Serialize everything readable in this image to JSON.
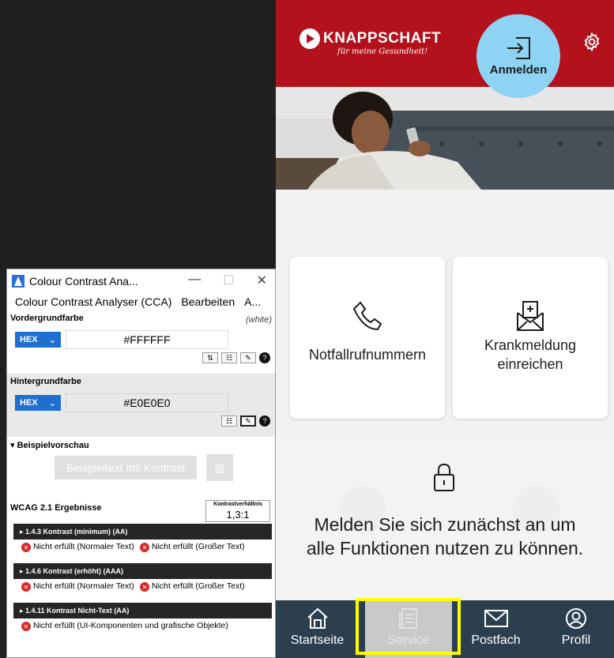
{
  "cca": {
    "title": "Colour Contrast Ana...",
    "menu": [
      "Colour Contrast Analyser (CCA)",
      "Bearbeiten",
      "A..."
    ],
    "window_controls": {
      "minimize": "—",
      "maximize": "☐",
      "close": "✕"
    },
    "foreground": {
      "label": "Vordergrundfarbe",
      "note": "(white)",
      "format": "HEX",
      "value": "#FFFFFF"
    },
    "background": {
      "label": "Hintergrundfarbe",
      "format": "HEX",
      "value": "#E0E0E0"
    },
    "preview": {
      "label": "▾ Beispielvorschau",
      "sample_text": "Beispieltext mit Kontrast"
    },
    "results": {
      "label": "WCAG 2.1 Ergebnisse",
      "ratio_label": "Kontrastverhältnis",
      "ratio_value": "1,3:1",
      "criteria": [
        {
          "title": "▸ 1.4.3 Kontrast (minimum) (AA)",
          "normal": "Nicht erfüllt (Normaler Text)",
          "large": "Nicht erfüllt (Großer Text)"
        },
        {
          "title": "▸ 1.4.6 Kontrast (erhöht) (AAA)",
          "normal": "Nicht erfüllt (Normaler Text)",
          "large": "Nicht erfüllt (Großer Text)"
        },
        {
          "title": "▸ 1.4.11 Kontrast Nicht-Text (AA)",
          "normal": "Nicht erfüllt (UI-Komponenten und grafische Objekte)"
        }
      ]
    }
  },
  "app": {
    "brand": "KNAPPSCHAFT",
    "tagline": "für meine Gesundheit!",
    "login_label": "Anmelden",
    "tiles": [
      {
        "label": "Notfallrufnummern",
        "icon": "phone-icon"
      },
      {
        "label": "Krankmeldung einreichen",
        "icon": "sick-note-icon"
      }
    ],
    "locked_message": "Melden Sie sich zunächst an um alle Funktionen nutzen zu können.",
    "nav": [
      {
        "label": "Startseite",
        "icon": "home-icon"
      },
      {
        "label": "Service",
        "icon": "service-icon",
        "selected": true
      },
      {
        "label": "Postfach",
        "icon": "mail-icon"
      },
      {
        "label": "Profil",
        "icon": "profile-icon"
      }
    ],
    "colors": {
      "brand_red": "#b3111b",
      "login_blue": "#8fd3f4",
      "navbar": "#2b3f4f",
      "highlight": "#ffff00"
    }
  }
}
